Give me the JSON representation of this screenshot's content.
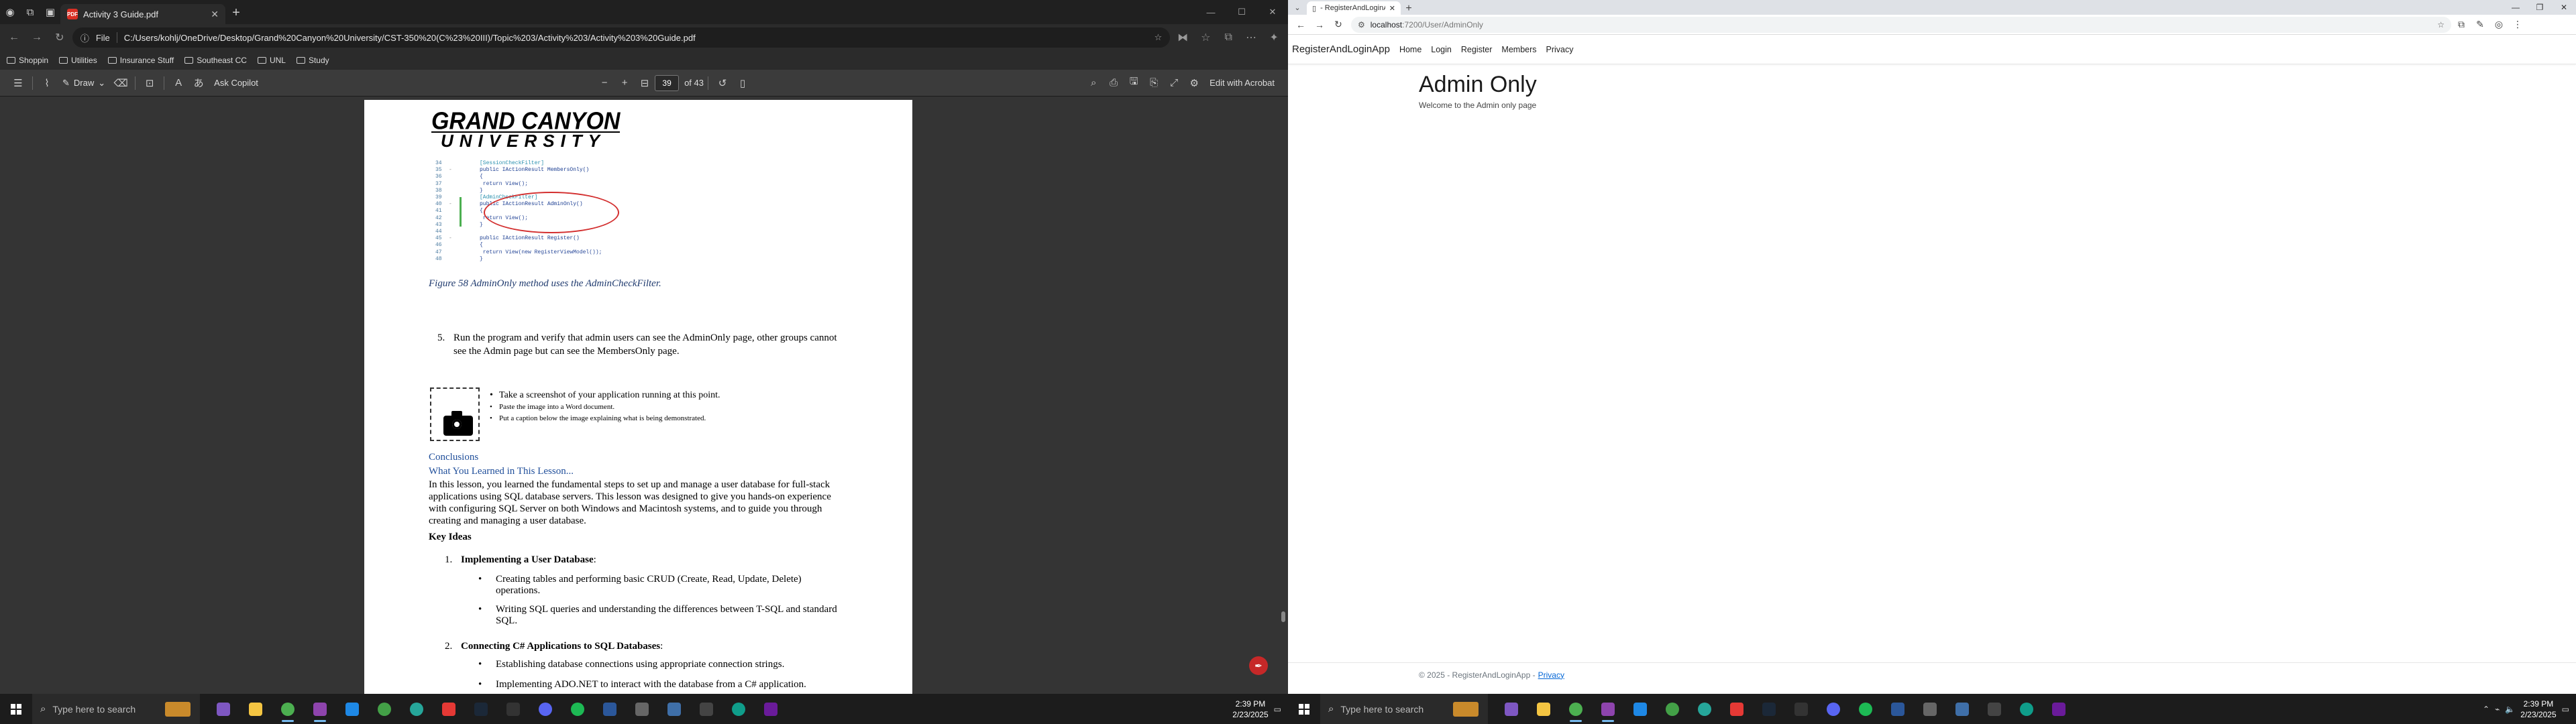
{
  "left": {
    "edge": {
      "tab_title": "Activity 3 Guide.pdf",
      "file_label": "File",
      "url": "C:/Users/kohlj/OneDrive/Desktop/Grand%20Canyon%20University/CST-350%20(C%23%20III)/Topic%203/Activity%203/Activity%203%20Guide.pdf",
      "bookmarks": [
        "Shoppin",
        "Utilities",
        "Insurance Stuff",
        "Southeast CC",
        "UNL",
        "Study"
      ]
    },
    "pdf_toolbar": {
      "draw_label": "Draw",
      "ask_copilot": "Ask Copilot",
      "page_current": "39",
      "page_total": "of 43",
      "edit_acrobat": "Edit with Acrobat"
    },
    "pdf": {
      "logo_line1": "GRAND CANYON",
      "logo_line2": "UNIVERSITY",
      "code_lines": [
        {
          "ln": "34",
          "gl": "",
          "text": "[SessionCheckFilter]",
          "cls": "attr"
        },
        {
          "ln": "35",
          "gl": "-",
          "text": "public IActionResult MembersOnly()",
          "cls": "kw"
        },
        {
          "ln": "36",
          "gl": "",
          "text": "{",
          "cls": ""
        },
        {
          "ln": "37",
          "gl": "",
          "text": "    return View();",
          "cls": ""
        },
        {
          "ln": "38",
          "gl": "",
          "text": "}",
          "cls": ""
        },
        {
          "ln": "39",
          "gl": "",
          "text": "[AdminCheckFilter]",
          "cls": "attr"
        },
        {
          "ln": "40",
          "gl": "-",
          "text": "public IActionResult AdminOnly()",
          "cls": "kw"
        },
        {
          "ln": "41",
          "gl": "",
          "text": "{",
          "cls": ""
        },
        {
          "ln": "42",
          "gl": "",
          "text": "    return View();",
          "cls": ""
        },
        {
          "ln": "43",
          "gl": "",
          "text": "}",
          "cls": ""
        },
        {
          "ln": "44",
          "gl": "",
          "text": "",
          "cls": ""
        },
        {
          "ln": "45",
          "gl": "-",
          "text": "public IActionResult Register()",
          "cls": "kw"
        },
        {
          "ln": "46",
          "gl": "",
          "text": "{",
          "cls": ""
        },
        {
          "ln": "47",
          "gl": "",
          "text": "    return View(new RegisterViewModel());",
          "cls": ""
        },
        {
          "ln": "48",
          "gl": "",
          "text": "}",
          "cls": ""
        }
      ],
      "fig_caption": "Figure 58 AdminOnly method uses the AdminCheckFilter.",
      "step5_num": "5.",
      "step5_text": "Run the program and verify that admin users can see the AdminOnly page, other groups cannot see the Admin page but can see the MembersOnly page.",
      "shot_items": [
        "Take a screenshot of your application running at this point.",
        "Paste the image into a Word document.",
        "Put a caption below the image explaining what is being demonstrated."
      ],
      "conclusions": "Conclusions",
      "learned": "What You Learned in This Lesson...",
      "paragraph": "In this lesson, you learned the fundamental steps to set up and manage a user database for full-stack applications using SQL database servers. This lesson was designed to give you hands-on experience with configuring SQL Server on both Windows and Macintosh systems, and to guide you through creating and managing a user database.",
      "key_ideas": "Key Ideas",
      "idea1_num": "1.",
      "idea1_title": "Implementing a User Database",
      "idea1_bullets": [
        "Creating tables and performing basic CRUD (Create, Read, Update, Delete) operations.",
        "Writing SQL queries and understanding the differences between T-SQL and standard SQL."
      ],
      "idea2_num": "2.",
      "idea2_title": "Connecting C# Applications to SQL Databases",
      "idea2_bullets": [
        "Establishing database connections using appropriate connection strings.",
        "Implementing ADO.NET to interact with the database from a C# application."
      ]
    },
    "taskbar": {
      "search_placeholder": "Type here to search",
      "time": "2:39 PM",
      "date": "2/23/2025"
    }
  },
  "right": {
    "chrome": {
      "tab_title": "- RegisterAndLoginApp",
      "url_host": "localhost",
      "url_path": ":7200/User/AdminOnly"
    },
    "site": {
      "brand": "RegisterAndLoginApp",
      "nav": [
        "Home",
        "Login",
        "Register",
        "Members",
        "Privacy"
      ],
      "heading": "Admin Only",
      "welcome": "Welcome to the Admin only page",
      "footer_text": "© 2025 - RegisterAndLoginApp -",
      "footer_link": "Privacy"
    },
    "taskbar": {
      "search_placeholder": "Type here to search",
      "time": "2:39 PM",
      "date": "2/23/2025"
    }
  },
  "colors": {
    "edge_bg": "#2b2b2b",
    "pdf_link_blue": "#1f4e9a",
    "annotation_red": "#d32f2f",
    "taskbar_bg": "#1c1c1c",
    "footer_link": "#0366d6"
  },
  "taskbar_apps": [
    {
      "name": "app-vs-purple",
      "color": "#7e57c2"
    },
    {
      "name": "app-file-explorer",
      "color": "#f4c542"
    },
    {
      "name": "app-chrome",
      "color": "#4caf50"
    },
    {
      "name": "app-visual-studio",
      "color": "#8e44ad"
    },
    {
      "name": "app-vscode",
      "color": "#1e88e5"
    },
    {
      "name": "app-green-circle",
      "color": "#43a047"
    },
    {
      "name": "app-edge",
      "color": "#26a69a"
    },
    {
      "name": "app-brave",
      "color": "#e53935"
    },
    {
      "name": "app-steam",
      "color": "#1b2838"
    },
    {
      "name": "app-terminal",
      "color": "#333333"
    },
    {
      "name": "app-discord",
      "color": "#5865f2"
    },
    {
      "name": "app-spotify",
      "color": "#1db954"
    },
    {
      "name": "app-word",
      "color": "#2b579a"
    },
    {
      "name": "app-sql",
      "color": "#666666"
    },
    {
      "name": "app-rstudio",
      "color": "#3f6fa8"
    },
    {
      "name": "app-calc",
      "color": "#444444"
    },
    {
      "name": "app-edge-2",
      "color": "#0f9d8a"
    },
    {
      "name": "app-purple",
      "color": "#6a1b9a"
    }
  ]
}
